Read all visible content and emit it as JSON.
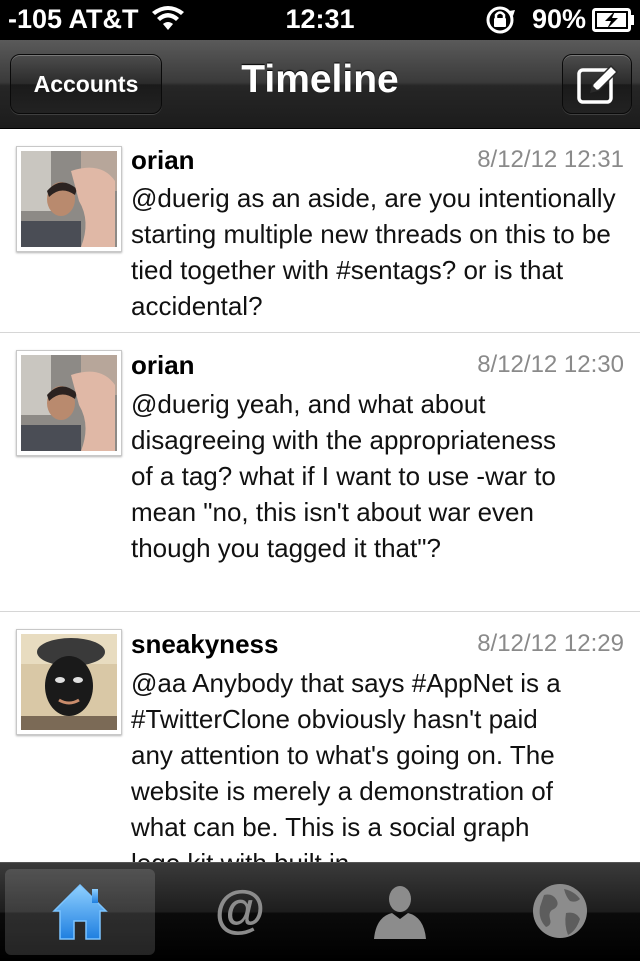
{
  "status_bar": {
    "carrier": "-105 AT&T",
    "time": "12:31",
    "battery_percent": "90%",
    "icons": [
      "wifi-icon",
      "rotation-lock-icon",
      "battery-charging-icon"
    ]
  },
  "nav": {
    "title": "Timeline",
    "accounts_label": "Accounts",
    "compose_icon": "compose-icon"
  },
  "tweets": [
    {
      "user": "orian",
      "time": "8/12/12 12:31",
      "text": "@duerig as an aside, are you intentionally starting multiple new threads on this to be tied together with #sentags? or is that accidental?"
    },
    {
      "user": "orian",
      "time": "8/12/12 12:30",
      "text": "@duerig yeah, and what about disagreeing with the appropriateness of a tag? what if I want to use -war to mean \"no, this isn't about war even though you tagged it that\"?"
    },
    {
      "user": "sneakyness",
      "time": "8/12/12 12:29",
      "text": "@aa Anybody that says #AppNet is a #TwitterClone obviously hasn't paid any attention to what's going on. The website is merely a demonstration of what can be. This is a social graph lego kit with built in"
    }
  ],
  "tabs": [
    {
      "icon": "home-icon",
      "active": true
    },
    {
      "icon": "mentions-icon",
      "active": false
    },
    {
      "icon": "profile-icon",
      "active": false
    },
    {
      "icon": "globe-icon",
      "active": false
    }
  ],
  "colors": {
    "nav_background": "#2b2b2b",
    "tab_active_blue": "#3ea6f5",
    "timestamp_gray": "#8a8a8a"
  }
}
